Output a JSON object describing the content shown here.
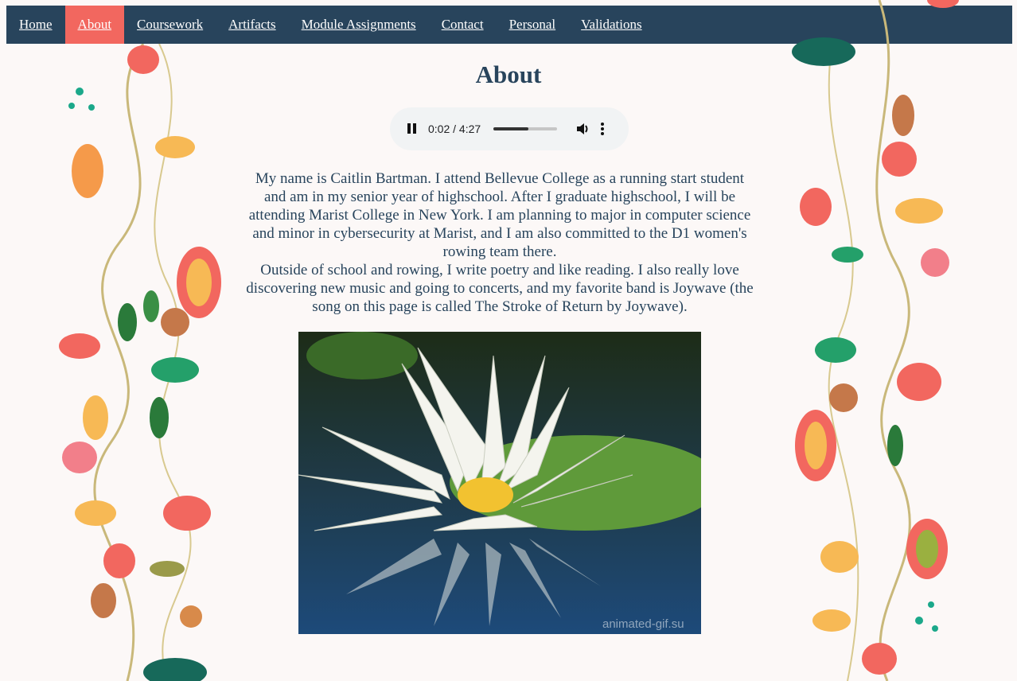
{
  "nav": {
    "items": [
      {
        "label": "Home"
      },
      {
        "label": "About",
        "active": true
      },
      {
        "label": "Coursework"
      },
      {
        "label": "Artifacts"
      },
      {
        "label": "Module Assignments"
      },
      {
        "label": "Contact"
      },
      {
        "label": "Personal"
      },
      {
        "label": "Validations"
      }
    ]
  },
  "page": {
    "title": "About"
  },
  "audio": {
    "time": "0:02 / 4:27",
    "progress": 0.55
  },
  "bio": {
    "paragraph1": "My name is Caitlin Bartman. I attend Bellevue College as a running start student and am in my senior year of highschool. After I graduate highschool, I will be attending Marist College in New York. I am planning to major in computer science and minor in cybersecurity at Marist, and I am also committed to the D1 women's rowing team there.",
    "paragraph2": "Outside of school and rowing, I write poetry and like reading. I also really love discovering new music and going to concerts, and my favorite band is Joywave (the song on this page is called The Stroke of Return by Joywave)."
  },
  "photo": {
    "watermark": "animated-gif.su"
  },
  "colors": {
    "nav_bg": "#28445c",
    "nav_active": "#f2675f",
    "text": "#28445c",
    "background": "#fcf8f7"
  }
}
